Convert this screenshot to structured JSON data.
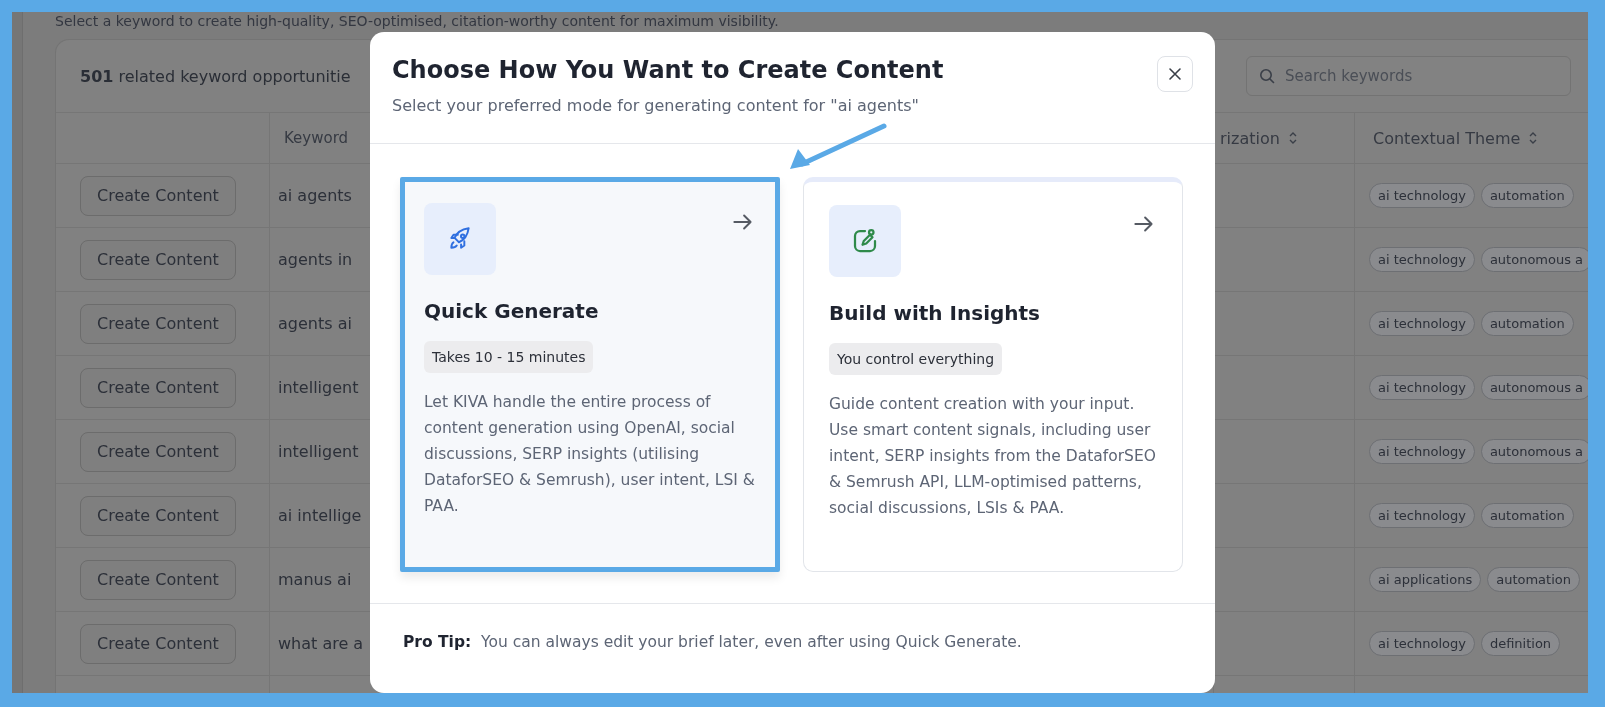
{
  "page": {
    "intro": "Select a keyword to create high-quality, SEO-optimised, citation-worthy content for maximum visibility.",
    "summary": "**501** related keyword opportunitie",
    "search": {
      "placeholder": "Search keywords"
    },
    "columns": [
      {
        "label": "Keyword"
      },
      {
        "label": "rization"
      },
      {
        "label": "Contextual Theme"
      }
    ],
    "rows": [
      {
        "action": "Create Content",
        "keyword": "ai agents",
        "themes": [
          "ai technology",
          "automation"
        ]
      },
      {
        "action": "Create Content",
        "keyword": "agents in",
        "themes": [
          "ai technology",
          "autonomous a"
        ]
      },
      {
        "action": "Create Content",
        "keyword": "agents ai",
        "themes": [
          "ai technology",
          "automation"
        ]
      },
      {
        "action": "Create Content",
        "keyword": "intelligent",
        "themes": [
          "ai technology",
          "autonomous a"
        ]
      },
      {
        "action": "Create Content",
        "keyword": "intelligent",
        "themes": [
          "ai technology",
          "autonomous a"
        ]
      },
      {
        "action": "Create Content",
        "keyword": "ai intellige",
        "themes": [
          "ai technology",
          "automation"
        ]
      },
      {
        "action": "Create Content",
        "keyword": "manus ai",
        "themes": [
          "ai applications",
          "automation"
        ]
      },
      {
        "action": "Create Content",
        "keyword": "what are a",
        "themes": [
          "ai technology",
          "definition"
        ]
      }
    ]
  },
  "modal": {
    "title": "Choose How You Want to Create Content",
    "subtitle": "Select your preferred mode for generating content for \"ai agents\"",
    "options": [
      {
        "kind": "rocket",
        "title": "Quick Generate",
        "badge": "Takes 10 - 15 minutes",
        "description": "Let KIVA handle the entire process of content generation using OpenAI, social discussions, SERP insights (utilising DataforSEO & Semrush), user intent, LSI & PAA.",
        "selected": true
      },
      {
        "kind": "edit",
        "title": "Build with Insights",
        "badge": "You control everything",
        "description": "Guide content creation with your input. Use smart content signals, including user intent, SERP insights from the DataforSEO & Semrush API, LLM-optimised patterns, social discussions, LSIs & PAA.",
        "selected": false
      }
    ],
    "tip_label": "Pro Tip:",
    "tip": "You can always edit your brief later, even after using Quick Generate."
  }
}
